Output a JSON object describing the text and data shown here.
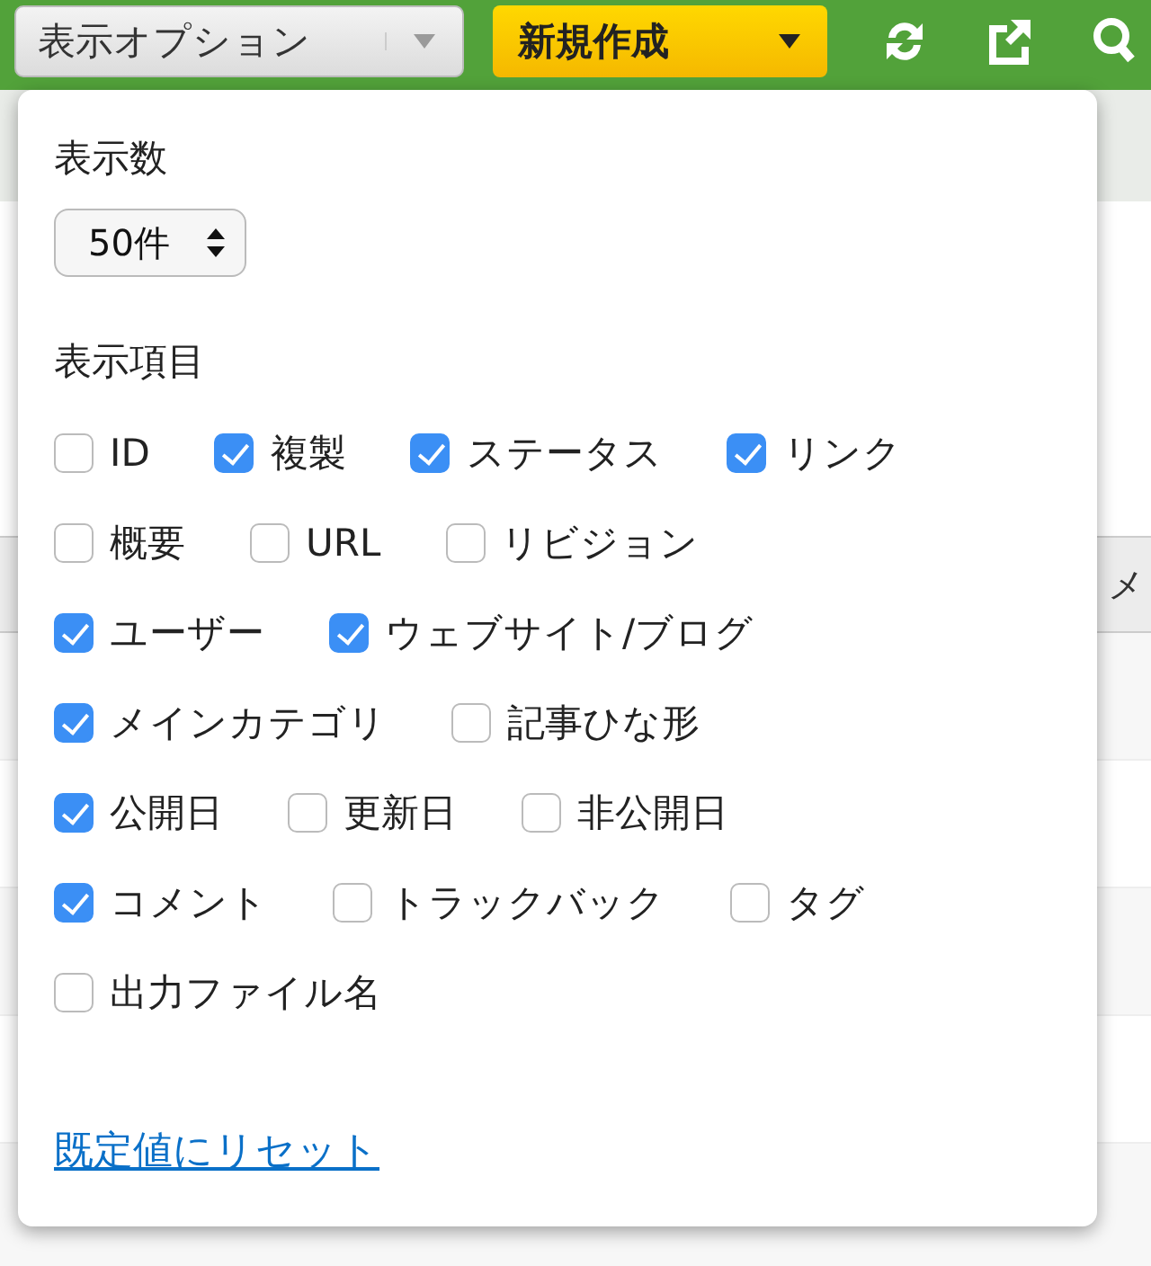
{
  "toolbar": {
    "options_button": "表示オプション",
    "new_button": "新規作成"
  },
  "table": {
    "header_fragment": "メ"
  },
  "popup": {
    "count_label": "表示数",
    "count_value": "50件",
    "columns_label": "表示項目",
    "lines": [
      {
        "items": [
          {
            "label": "ID",
            "checked": false
          },
          {
            "label": "複製",
            "checked": true
          },
          {
            "label": "ステータス",
            "checked": true
          },
          {
            "label": "リンク",
            "checked": true
          }
        ]
      },
      {
        "items": [
          {
            "label": "概要",
            "checked": false
          },
          {
            "label": "URL",
            "checked": false
          },
          {
            "label": "リビジョン",
            "checked": false
          }
        ]
      },
      {
        "items": [
          {
            "label": "ユーザー",
            "checked": true
          },
          {
            "label": "ウェブサイト/ブログ",
            "checked": true
          }
        ]
      },
      {
        "items": [
          {
            "label": "メインカテゴリ",
            "checked": true
          },
          {
            "label": "記事ひな形",
            "checked": false
          }
        ]
      },
      {
        "items": [
          {
            "label": "公開日",
            "checked": true
          },
          {
            "label": "更新日",
            "checked": false
          },
          {
            "label": "非公開日",
            "checked": false
          }
        ]
      },
      {
        "items": [
          {
            "label": "コメント",
            "checked": true
          },
          {
            "label": "トラックバック",
            "checked": false
          },
          {
            "label": "タグ",
            "checked": false
          }
        ]
      },
      {
        "items": [
          {
            "label": "出力ファイル名",
            "checked": false
          }
        ]
      }
    ],
    "reset_link": "既定値にリセット"
  }
}
